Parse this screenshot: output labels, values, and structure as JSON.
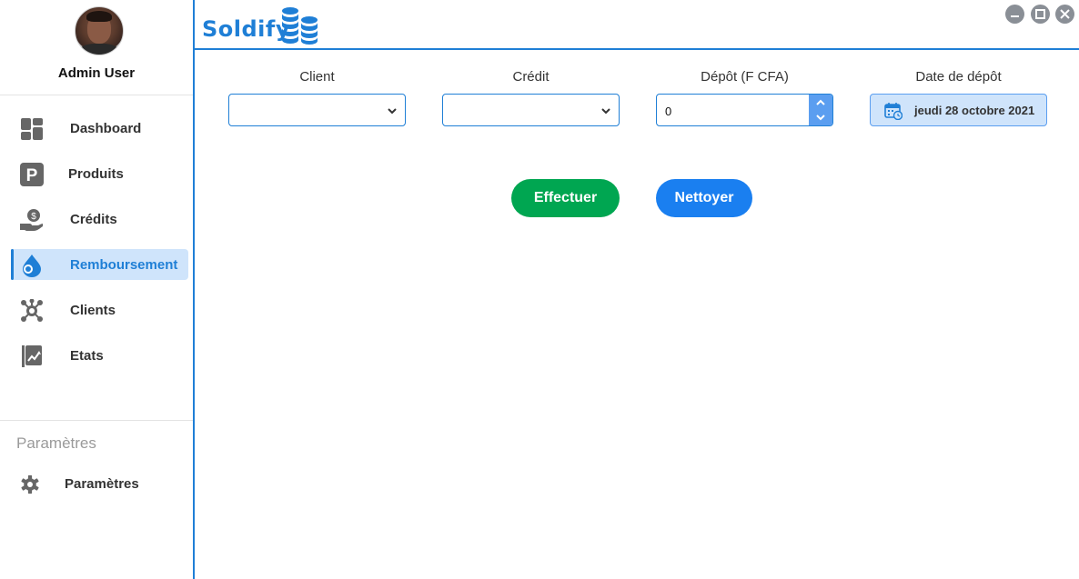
{
  "user": {
    "name": "Admin User"
  },
  "sidebar": {
    "items": [
      {
        "label": "Dashboard",
        "icon": "dashboard-icon"
      },
      {
        "label": "Produits",
        "icon": "produits-icon"
      },
      {
        "label": "Crédits",
        "icon": "credit-hand-icon"
      },
      {
        "label": "Remboursement",
        "icon": "remboursement-icon",
        "active": true
      },
      {
        "label": "Clients",
        "icon": "clients-network-icon"
      },
      {
        "label": "Etats",
        "icon": "chart-icon"
      }
    ],
    "settings_section_title": "Paramètres",
    "settings_item": {
      "label": "Paramètres",
      "icon": "gear-icon"
    }
  },
  "header": {
    "brand": "Soldify",
    "brand_icon": "coins-stack-icon",
    "window_controls": [
      "minimize-icon",
      "maximize-icon",
      "close-icon"
    ]
  },
  "form": {
    "client": {
      "label": "Client",
      "value": ""
    },
    "credit": {
      "label": "Crédit",
      "value": ""
    },
    "depot": {
      "label": "Dépôt (F CFA)",
      "value": "0"
    },
    "date": {
      "label": "Date de dépôt",
      "value": "jeudi 28 octobre 2021"
    }
  },
  "actions": {
    "submit_label": "Effectuer",
    "clear_label": "Nettoyer"
  },
  "colors": {
    "accent": "#1f7fd6",
    "active_bg": "#cfe4fb",
    "submit_bg": "#00a651",
    "clear_bg": "#1a7ff0",
    "window_btn": "#8a8f96"
  }
}
